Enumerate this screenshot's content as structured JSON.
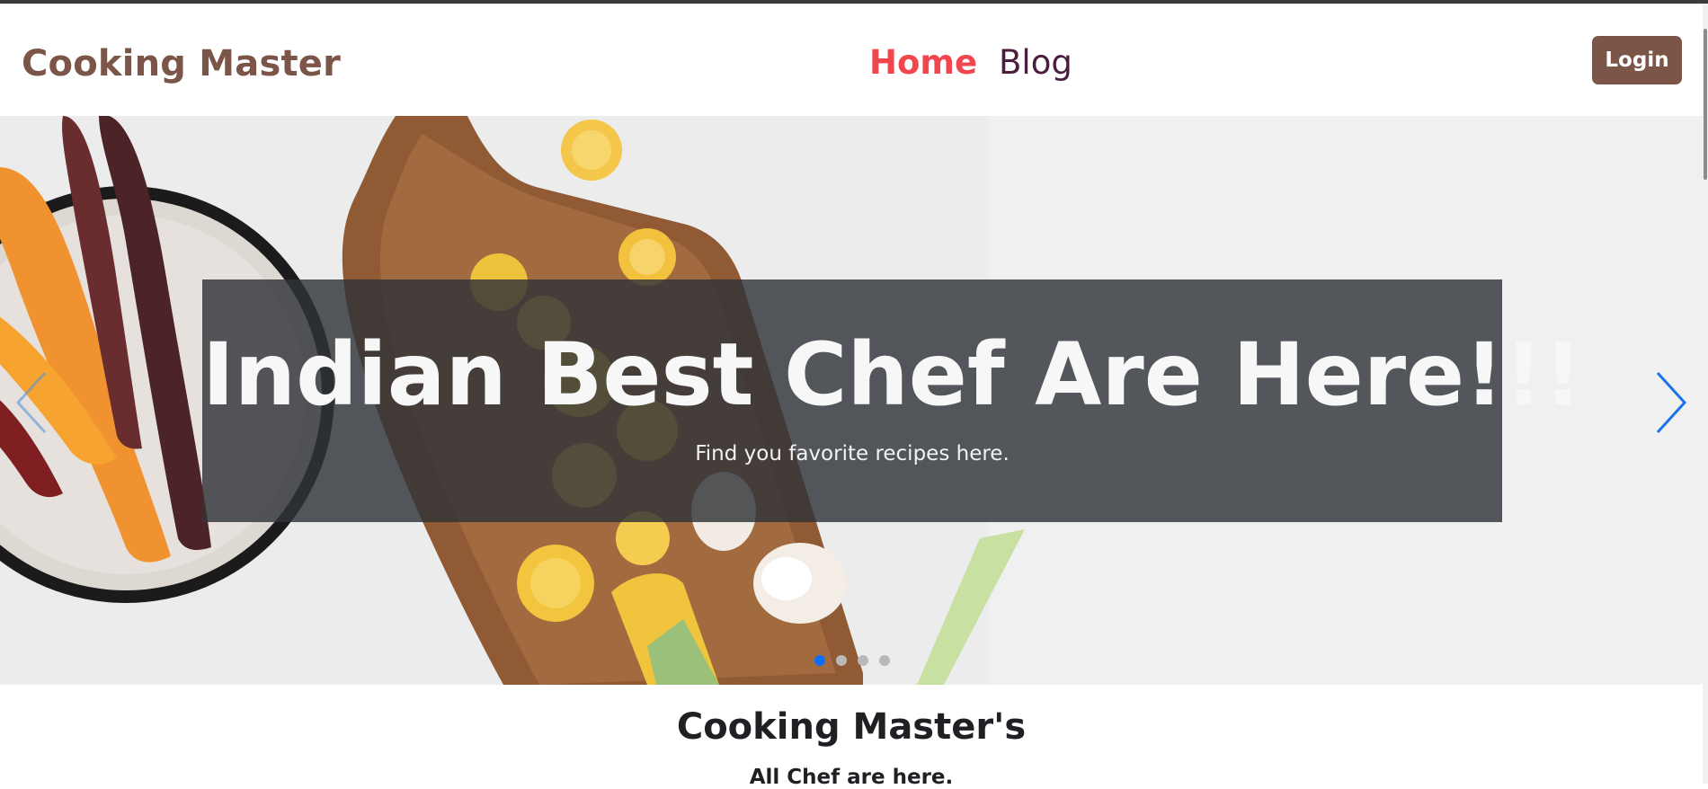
{
  "navbar": {
    "brand": "Cooking Master",
    "links": [
      {
        "label": "Home",
        "active": true
      },
      {
        "label": "Blog",
        "active": false
      }
    ],
    "login_label": "Login"
  },
  "carousel": {
    "title": "Indian Best Chef Are Here!!!",
    "subtitle": "Find you favorite recipes here.",
    "slide_count": 4,
    "active_slide": 1,
    "prev_icon": "chevron-left-icon",
    "next_icon": "chevron-right-icon"
  },
  "section": {
    "title": "Cooking Master's",
    "subtitle": "All Chef are here."
  },
  "colors": {
    "brand": "#7a5548",
    "nav_active": "#f0474f",
    "nav_link": "#4b1d3f",
    "indicator_active": "#0d6efd",
    "caption_bg": "#303338"
  }
}
